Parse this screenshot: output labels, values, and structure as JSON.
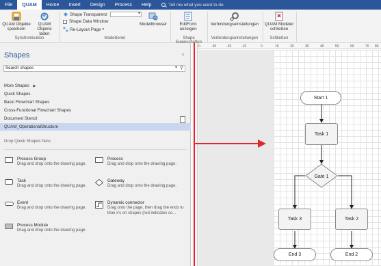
{
  "tabs": [
    "File",
    "QUAM",
    "Home",
    "Insert",
    "Design",
    "Process",
    "Help"
  ],
  "active_tab": "QUAM",
  "tell_me": "Tell me what you want to do",
  "ribbon": {
    "save_objects": "QUAM Objekte speichern",
    "load_objects": "QUAM Objekte laden",
    "sync_group": "Synchronisation",
    "shape_transparency": "Shape Transparenz",
    "shape_data_window": "Shape Data Window",
    "relayout_page": "Re-Layout Page",
    "modellbrowser": "Modellbrowser",
    "modellieren_group": "Modellieren",
    "editform": "EditForm anzeigen",
    "shape_eigenschaften_group": "Shape Eigenschaften",
    "verbindungseinstellungen": "Verbindungseinstellungen",
    "verbindungseinstellungen_group": "Verbindungseinstellungen",
    "close_modeler": "QUAM Modeler schließen",
    "schliessen_group": "Schließen"
  },
  "shapes_pane": {
    "title": "Shapes",
    "search_placeholder": "Search shapes",
    "stencils": [
      "More Shapes",
      "Quick Shapes",
      "Basic Flowchart Shapes",
      "Cross-Functional Flowchart Shapes",
      "Document Stencil",
      "QUAM_OperationalStructure"
    ],
    "selected_stencil": "QUAM_OperationalStructure",
    "drop_hint": "Drop Quick Shapes here",
    "shapes": [
      {
        "name": "Process Group",
        "desc": "Drag and drop onto the drawing page.",
        "icon": "rectangle-icon"
      },
      {
        "name": "Process",
        "desc": "Drag and drop onto the drawing page.",
        "icon": "rectangle-icon"
      },
      {
        "name": "Task",
        "desc": "Drag and drop onto the drawing page.",
        "icon": "rounded-rectangle-icon"
      },
      {
        "name": "Gateway",
        "desc": "Drag and drop onto the drawing page.",
        "icon": "diamond-icon"
      },
      {
        "name": "Event",
        "desc": "Drag and drop onto the drawing page.",
        "icon": "pill-icon"
      },
      {
        "name": "Dynamic connector",
        "desc": "Drag onto the page, then drag the ends to blue x's on shapes (red indicates co...",
        "icon": "connector-icon"
      },
      {
        "name": "Process Module",
        "desc": "Drag and drop onto the drawing page.",
        "icon": "gray-rectangle-icon"
      }
    ]
  },
  "ruler_labels": [
    "0",
    "-30",
    "-20",
    "-10",
    "0",
    "10",
    "20",
    "30",
    "40",
    "50",
    "60",
    "70",
    "80"
  ],
  "flowchart": {
    "start": "Start 1",
    "task1": "Task 1",
    "gate": "Gate 1",
    "task3": "Task 3",
    "task2": "Task 2",
    "end3": "End 3",
    "end2": "End 2"
  },
  "colors": {
    "accent": "#2b579a",
    "annotation_red": "#e2262b"
  }
}
